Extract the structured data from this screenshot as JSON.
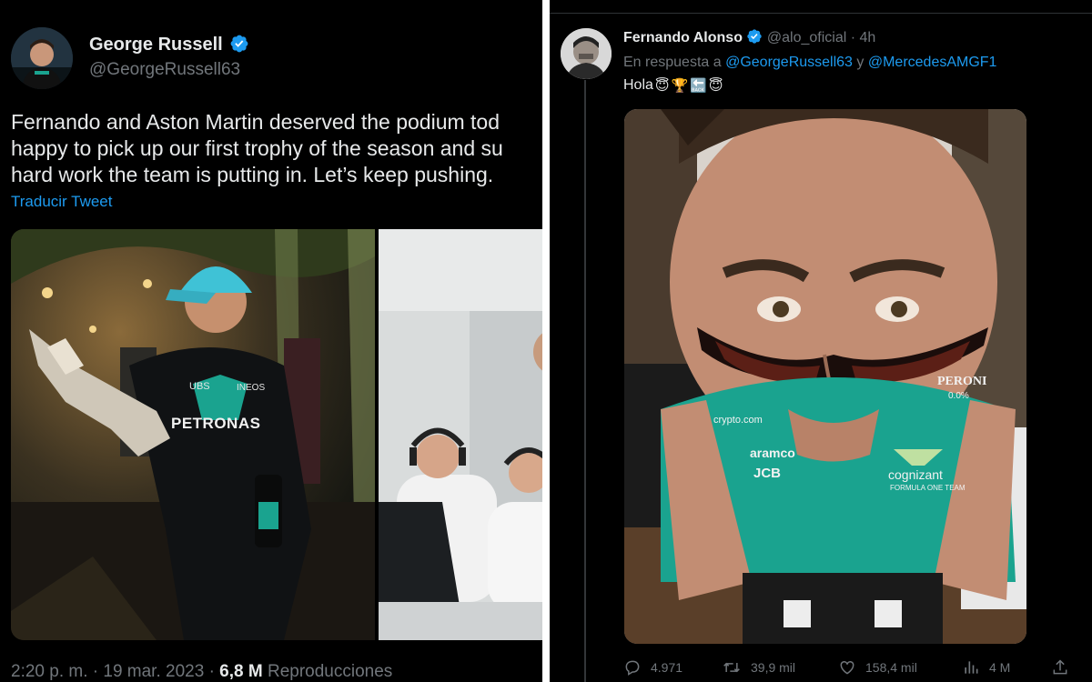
{
  "left_tweet": {
    "author_name": "George Russell",
    "author_handle": "@GeorgeRussell63",
    "text_lines": [
      "Fernando and Aston Martin deserved the podium tod",
      "happy to pick up our first trophy of the season and su",
      "hard work the team is putting in. Let’s keep pushing."
    ],
    "translate_label": "Traducir Tweet",
    "timestamp": "2:20 p. m. · 19 mar. 2023 · ",
    "views_count": "6,8 M",
    "views_label": " Reproducciones",
    "photo_texts": {
      "suit_brand": "PETRONAS",
      "sponsor_ubs": "UBS",
      "sponsor_ineos": "INEOS"
    }
  },
  "right_tweet": {
    "author_name": "Fernando Alonso",
    "author_handle": "@alo_oficial",
    "time_ago": " · 4h",
    "reply_prefix": "En respuesta a ",
    "reply_user_1": "@GeorgeRussell63",
    "reply_conjunction": " y ",
    "reply_user_2": "@MercedesAMGF1",
    "text": "Hola",
    "emoji_halo": "😇",
    "emoji_trophy": "🏆",
    "emoji_back": "🔙",
    "photo_texts": {
      "brand_peroni": "PERONI",
      "brand_peroni_sub": "0.0%",
      "brand_crypto": "crypto.com",
      "brand_aramco": "aramco",
      "brand_jcb": "JCB",
      "brand_cognizant": "cognizant",
      "brand_cognizant_sub": "FORMULA ONE TEAM"
    },
    "actions": {
      "replies": "4.971",
      "retweets": "39,9 mil",
      "likes": "158,4 mil",
      "views": "4 M"
    }
  },
  "colors": {
    "background": "#000000",
    "text_primary": "#e7e9ea",
    "text_secondary": "#71767b",
    "link": "#1d9bf0",
    "verified": "#1d9bf0",
    "teal_shirt": "#1aa38f"
  }
}
